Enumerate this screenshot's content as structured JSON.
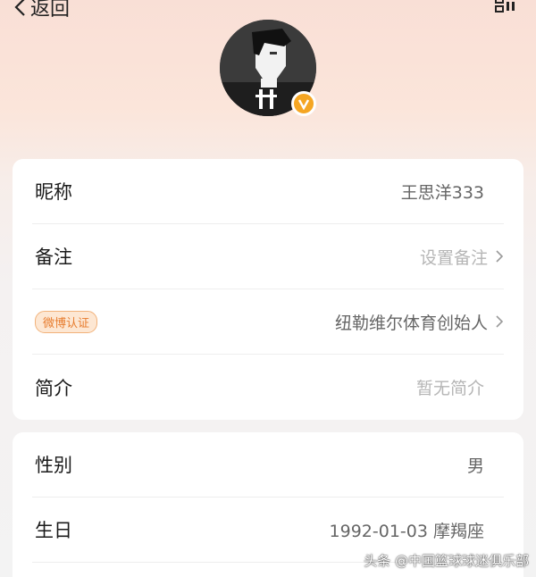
{
  "topbar": {
    "back_label": "返回"
  },
  "profile": {
    "verified_icon": "v-badge-icon"
  },
  "card1": {
    "rows": [
      {
        "label": "昵称",
        "value": "王思洋333"
      },
      {
        "label": "备注",
        "value": "设置备注"
      },
      {
        "label": "微博认证",
        "value": "纽勒维尔体育创始人"
      },
      {
        "label": "简介",
        "value": "暂无简介"
      }
    ]
  },
  "card2": {
    "rows": [
      {
        "label": "性别",
        "value": "男"
      },
      {
        "label": "生日",
        "value": "1992-01-03 摩羯座"
      }
    ]
  },
  "watermark": "头条 @中国篮球球迷俱乐部",
  "colors": {
    "accent": "#f5a623",
    "tag": "#e77c2e"
  }
}
